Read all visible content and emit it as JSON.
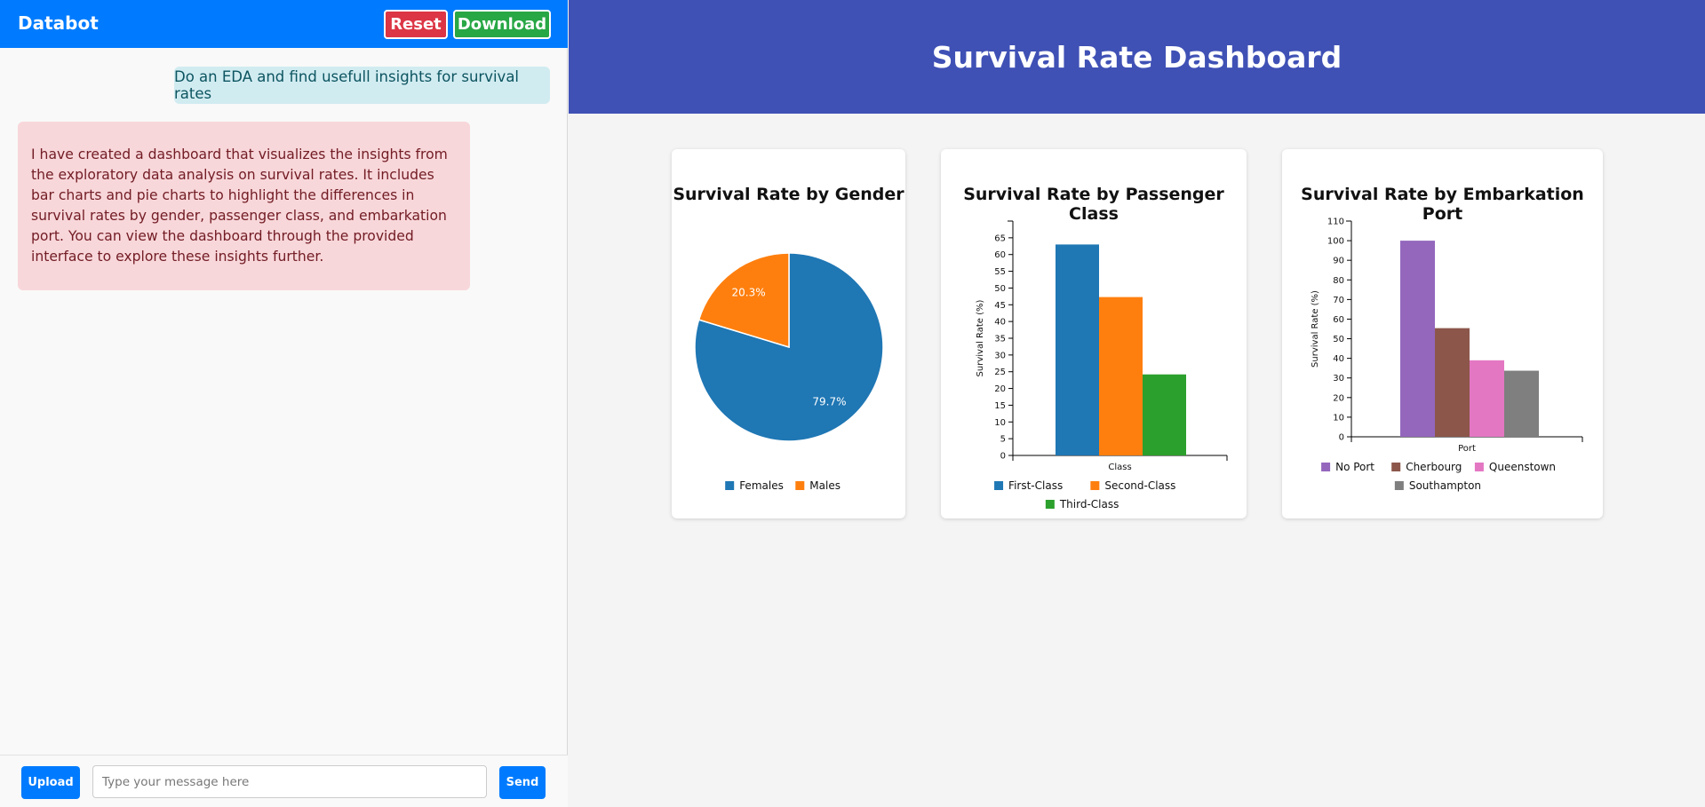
{
  "app": {
    "title": "Databot",
    "reset_label": "Reset",
    "download_label": "Download"
  },
  "chat": {
    "messages": [
      {
        "role": "user",
        "text": "Do an EDA and find usefull insights for survival rates"
      },
      {
        "role": "bot",
        "text": "I have created a dashboard that visualizes the insights from the exploratory data analysis on survival rates. It includes bar charts and pie charts to highlight the differences in survival rates by gender, passenger class, and embarkation port. You can view the dashboard through the provided interface to explore these insights further."
      }
    ],
    "upload_label": "Upload",
    "input_placeholder": "Type your message here",
    "input_value": "",
    "send_label": "Send"
  },
  "dashboard": {
    "title": "Survival Rate Dashboard"
  },
  "colors": {
    "header": "#007bff",
    "dashboard_header": "#3f51b5",
    "reset": "#dc3545",
    "download": "#28a745",
    "user_bubble": "#d1ecf1",
    "bot_bubble": "#f8d7da"
  },
  "chart_data": [
    {
      "type": "pie",
      "title": "Survival Rate by Gender",
      "slices": [
        {
          "label": "Females",
          "value": 79.7,
          "display": "79.7%",
          "color": "#1f77b4"
        },
        {
          "label": "Males",
          "value": 20.3,
          "display": "20.3%",
          "color": "#ff7f0e"
        }
      ],
      "legend": "bottom"
    },
    {
      "type": "bar",
      "title": "Survival Rate by Passenger Class",
      "categories": [
        "First-Class",
        "Second-Class",
        "Third-Class"
      ],
      "values": [
        63.0,
        47.3,
        24.2
      ],
      "colors": [
        "#1f77b4",
        "#ff7f0e",
        "#2ca02c"
      ],
      "xlabel": "Class",
      "ylabel": "Survival Rate (%)",
      "ylim": [
        0,
        70
      ],
      "yticks": [
        0,
        5,
        10,
        15,
        20,
        25,
        30,
        35,
        40,
        45,
        50,
        55,
        60,
        65
      ],
      "legend": "bottom"
    },
    {
      "type": "bar",
      "title": "Survival Rate by Embarkation Port",
      "categories": [
        "No Port",
        "Cherbourg",
        "Queenstown",
        "Southampton"
      ],
      "values": [
        100.0,
        55.4,
        39.0,
        33.7
      ],
      "colors": [
        "#9467bd",
        "#8c564b",
        "#e377c2",
        "#7f7f7f"
      ],
      "xlabel": "Port",
      "ylabel": "Survival Rate (%)",
      "ylim": [
        0,
        110
      ],
      "yticks": [
        0,
        10,
        20,
        30,
        40,
        50,
        60,
        70,
        80,
        90,
        100,
        110
      ],
      "legend": "bottom"
    }
  ]
}
